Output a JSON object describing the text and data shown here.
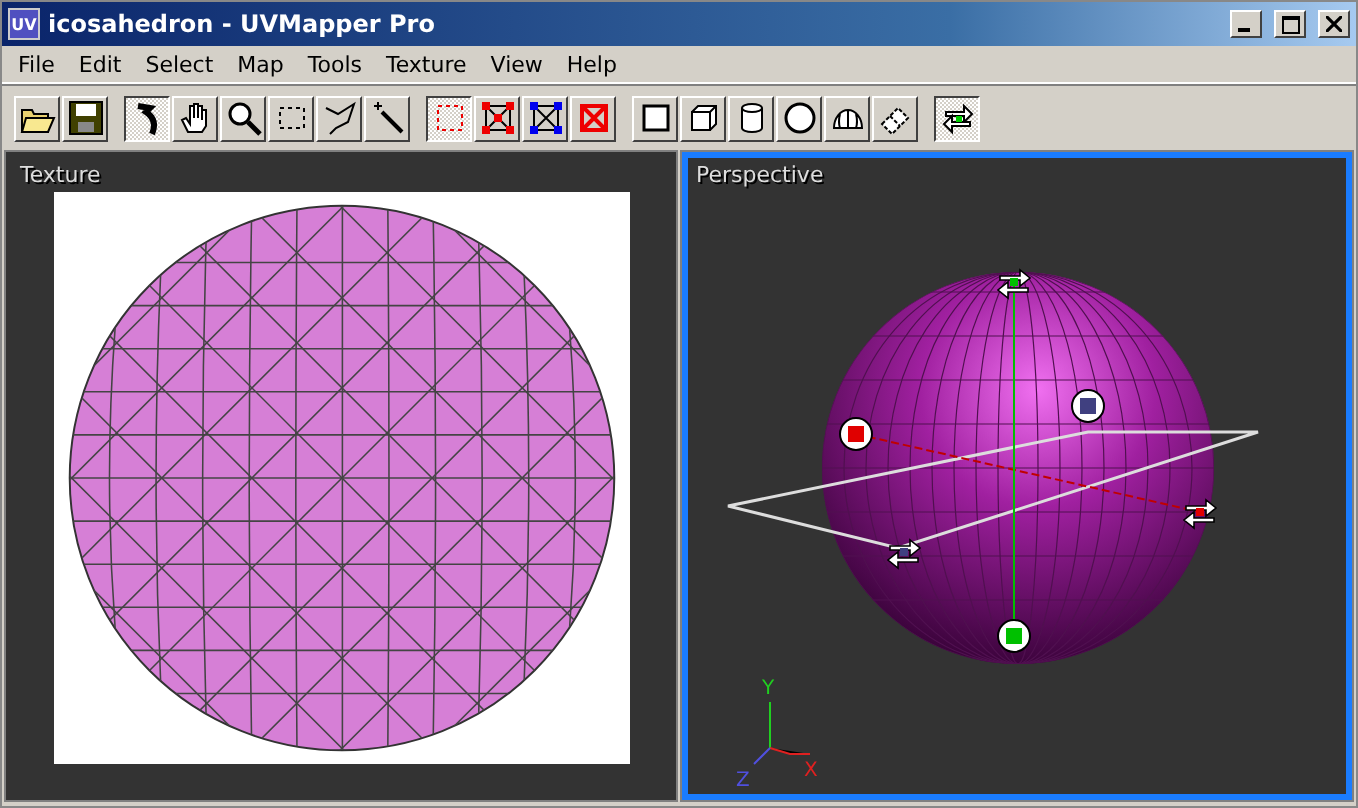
{
  "window": {
    "title": "icosahedron - UVMapper Pro",
    "app_icon": "UV"
  },
  "menu": [
    {
      "label": "File"
    },
    {
      "label": "Edit"
    },
    {
      "label": "Select"
    },
    {
      "label": "Map"
    },
    {
      "label": "Tools"
    },
    {
      "label": "Texture"
    },
    {
      "label": "View"
    },
    {
      "label": "Help"
    }
  ],
  "toolbar": [
    [
      {
        "kind": "open",
        "selected": false
      },
      {
        "kind": "save",
        "selected": false
      }
    ],
    [
      {
        "kind": "pointer",
        "selected": true
      },
      {
        "kind": "hand",
        "selected": false
      },
      {
        "kind": "zoom",
        "selected": false
      },
      {
        "kind": "marquee",
        "selected": false
      },
      {
        "kind": "lasso",
        "selected": false
      },
      {
        "kind": "wand",
        "selected": false
      }
    ],
    [
      {
        "kind": "sel-none",
        "selected": true
      },
      {
        "kind": "sel-red",
        "selected": false
      },
      {
        "kind": "sel-blue",
        "selected": false
      },
      {
        "kind": "sel-cross",
        "selected": false
      }
    ],
    [
      {
        "kind": "plane",
        "selected": false
      },
      {
        "kind": "box",
        "selected": false
      },
      {
        "kind": "cylinder",
        "selected": false
      },
      {
        "kind": "sphere",
        "selected": false
      },
      {
        "kind": "dome",
        "selected": false
      },
      {
        "kind": "strip",
        "selected": false
      }
    ],
    [
      {
        "kind": "swap",
        "selected": true
      }
    ]
  ],
  "texture_view": {
    "label": "Texture"
  },
  "perspective_view": {
    "label": "Perspective",
    "active": true,
    "axes": [
      "X",
      "Y",
      "Z"
    ]
  }
}
